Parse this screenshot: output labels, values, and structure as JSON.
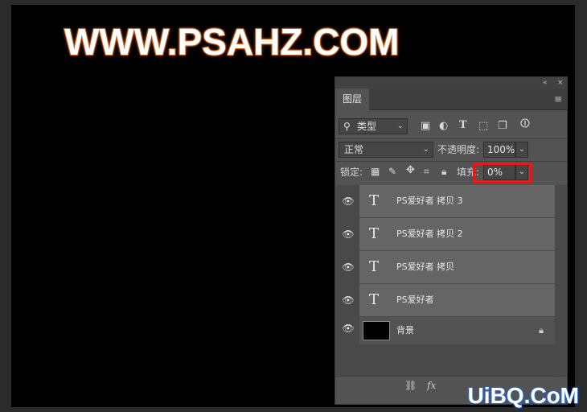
{
  "watermark_top": "WWW.PSAHZ.COM",
  "watermark_bottom": "UiBQ.CoM",
  "panel": {
    "collapse_icon": "«",
    "close_icon": "×",
    "tab_label": "图层",
    "menu_icon": "≡",
    "filter": {
      "kind_icon": "search-icon",
      "kind_label": "类型",
      "icons": [
        "image-filter-icon",
        "adjustment-filter-icon",
        "type-filter-icon",
        "shape-filter-icon",
        "smartobject-filter-icon",
        "filter-toggle-icon"
      ]
    },
    "blend_mode": "正常",
    "opacity_label": "不透明度:",
    "opacity_value": "100%",
    "lock_label": "锁定:",
    "fill_label": "填充:",
    "fill_value": "0%",
    "layers": [
      {
        "name": "PS爱好者 拷贝 3",
        "type": "text"
      },
      {
        "name": "PS爱好者 拷贝 2",
        "type": "text"
      },
      {
        "name": "PS爱好者 拷贝",
        "type": "text"
      },
      {
        "name": "PS爱好者",
        "type": "text"
      },
      {
        "name": "背景",
        "type": "image",
        "locked": true
      }
    ],
    "footer_icons": [
      "link-icon",
      "fx-icon"
    ]
  },
  "colors": {
    "highlight": "#e01b1b",
    "watermark_stroke": "#c8621e",
    "watermark_bottom_stroke": "#2a6bd6"
  }
}
